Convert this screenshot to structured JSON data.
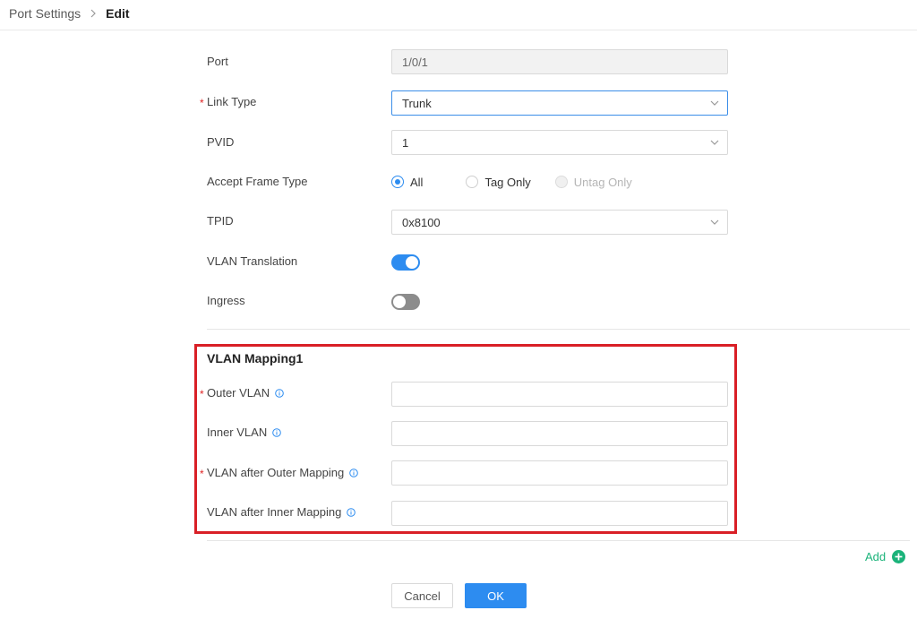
{
  "breadcrumb": {
    "parent": "Port Settings",
    "current": "Edit"
  },
  "form": {
    "port": {
      "label": "Port",
      "value": "1/0/1"
    },
    "link_type": {
      "label": "Link Type",
      "value": "Trunk",
      "required_mark": "*"
    },
    "pvid": {
      "label": "PVID",
      "value": "1"
    },
    "accept_frame_type": {
      "label": "Accept Frame Type",
      "options": [
        "All",
        "Tag Only",
        "Untag Only"
      ],
      "selected": "All"
    },
    "tpid": {
      "label": "TPID",
      "value": "0x8100"
    },
    "vlan_translation": {
      "label": "VLAN Translation",
      "enabled": true
    },
    "ingress": {
      "label": "Ingress",
      "enabled": false
    }
  },
  "vlan_mapping": {
    "title": "VLAN Mapping1",
    "outer_vlan": {
      "label": "Outer VLAN",
      "value": "",
      "required_mark": "*"
    },
    "inner_vlan": {
      "label": "Inner VLAN",
      "value": ""
    },
    "vlan_after_outer": {
      "label": "VLAN after Outer Mapping",
      "value": "",
      "required_mark": "*"
    },
    "vlan_after_inner": {
      "label": "VLAN after Inner Mapping",
      "value": ""
    }
  },
  "actions": {
    "add_label": "Add",
    "cancel_label": "Cancel",
    "ok_label": "OK"
  },
  "colors": {
    "primary": "#2d8cf0",
    "add_green": "#1bb37a",
    "required_red": "#e02424",
    "highlight_red": "#d91f26"
  }
}
